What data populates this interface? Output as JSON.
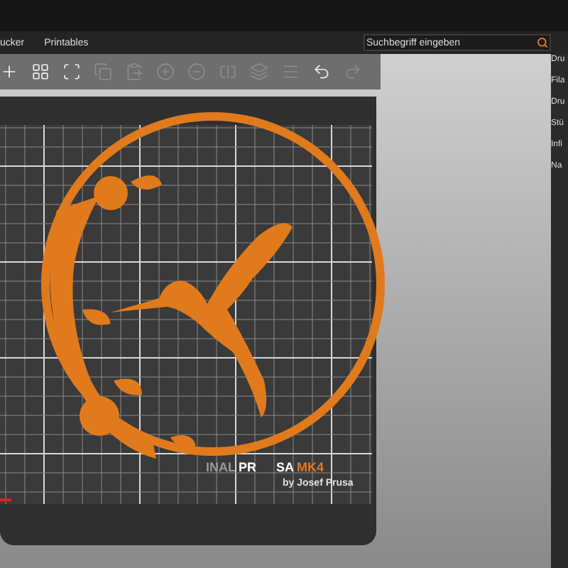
{
  "menu_tabs": [
    {
      "label": "ucker",
      "selected": false
    },
    {
      "label": "Printables",
      "selected": false
    }
  ],
  "search": {
    "placeholder": "Suchbegriff eingeben"
  },
  "toolbar": [
    {
      "kind": "add",
      "disabled": false
    },
    {
      "kind": "arrange",
      "disabled": false
    },
    {
      "kind": "arrange-selection",
      "disabled": false
    },
    {
      "kind": "copy",
      "disabled": true
    },
    {
      "kind": "paste",
      "disabled": true
    },
    {
      "kind": "plus",
      "disabled": true
    },
    {
      "kind": "minus",
      "disabled": true
    },
    {
      "kind": "split-objects",
      "disabled": true
    },
    {
      "kind": "split-parts",
      "disabled": true
    },
    {
      "kind": "layers",
      "disabled": true
    },
    {
      "kind": "undo",
      "disabled": false
    },
    {
      "kind": "redo",
      "disabled": true
    }
  ],
  "bed": {
    "logo": [
      {
        "text": "INAL",
        "kind": "gray"
      },
      {
        "text": "PR",
        "kind": "white"
      },
      {
        "text": "SA",
        "kind": "white"
      },
      {
        "text": "MK4",
        "kind": "orange"
      }
    ],
    "subtitle": "by Josef Prusa"
  },
  "side_panel": {
    "labels": [
      "Dru",
      "Fila",
      "Dru",
      "Stü",
      "Infi",
      "Na"
    ]
  }
}
